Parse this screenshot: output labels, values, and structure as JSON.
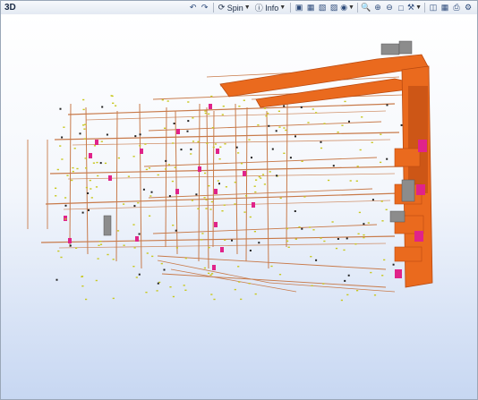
{
  "window": {
    "title": "3D"
  },
  "toolbar": {
    "nav_back_icon": "arrow-back-icon",
    "nav_forward_icon": "arrow-forward-icon",
    "spin_label": "Spin",
    "info_label": "Info"
  },
  "colors": {
    "duct": "#ea6a1e",
    "duct_dark": "#b94a10",
    "pipe": "#c87a4a",
    "fixture": "#e0238a",
    "equipment": "#8c8c8c",
    "sprinkler": "#c8c81e",
    "bg_top": "#ffffff",
    "bg_bottom": "#c7d7f2"
  }
}
